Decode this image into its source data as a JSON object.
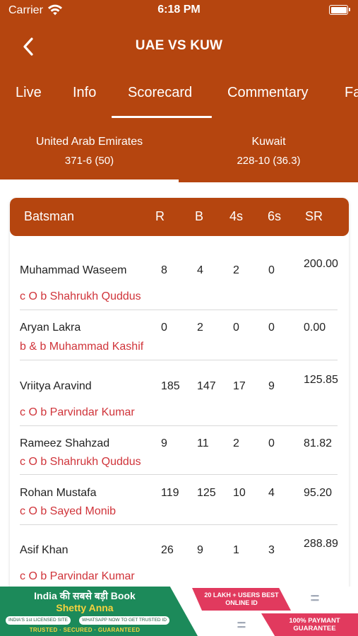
{
  "status_bar": {
    "carrier": "Carrier",
    "time": "6:18 PM"
  },
  "header": {
    "title": "UAE VS KUW"
  },
  "tabs": [
    {
      "label": "Live"
    },
    {
      "label": "Info"
    },
    {
      "label": "Scorecard"
    },
    {
      "label": "Commentary"
    },
    {
      "label": "Fa"
    }
  ],
  "teams": [
    {
      "name": "United Arab Emirates",
      "score": "371-6 (50)"
    },
    {
      "name": "Kuwait",
      "score": "228-10 (36.3)"
    }
  ],
  "batting": {
    "columns": [
      "Batsman",
      "R",
      "B",
      "4s",
      "6s",
      "SR"
    ],
    "rows": [
      {
        "name": "Muhammad Waseem",
        "dismissal": "c O b Shahrukh Quddus",
        "r": "8",
        "b": "4",
        "fours": "2",
        "sixes": "0",
        "sr": "200.00"
      },
      {
        "name": "Aryan Lakra",
        "dismissal": "b & b Muhammad Kashif",
        "r": "0",
        "b": "2",
        "fours": "0",
        "sixes": "0",
        "sr": "0.00"
      },
      {
        "name": "Vriitya Aravind",
        "dismissal": "c O b Parvindar Kumar",
        "r": "185",
        "b": "147",
        "fours": "17",
        "sixes": "9",
        "sr": "125.85"
      },
      {
        "name": "Rameez Shahzad",
        "dismissal": "c O b Shahrukh Quddus",
        "r": "9",
        "b": "11",
        "fours": "2",
        "sixes": "0",
        "sr": "81.82"
      },
      {
        "name": "Rohan Mustafa",
        "dismissal": "c O b Sayed Monib",
        "r": "119",
        "b": "125",
        "fours": "10",
        "sixes": "4",
        "sr": "95.20"
      },
      {
        "name": "Asif Khan",
        "dismissal": "c O b Parvindar Kumar",
        "r": "26",
        "b": "9",
        "fours": "1",
        "sixes": "3",
        "sr": "288.89"
      }
    ]
  },
  "ad": {
    "line1": "India की सबसे बड़ी Book",
    "line2": "Shetty Anna",
    "pill1": "INDIA'S 1st LICENSED SITE",
    "pill2": "WHATSAPP NOW TO GET TRUSTED ID",
    "line3": "TRUSTED · SECURED · GUARANTEED",
    "badge1": "20 LAKH + USERS BEST ONLINE ID",
    "badge2": "100% PAYMANT GUARANTEE"
  },
  "colors": {
    "primary": "#b5450f",
    "dismissal": "#d0343a",
    "ad_green": "#1c8a5a",
    "ad_pink": "#e13a5e"
  }
}
